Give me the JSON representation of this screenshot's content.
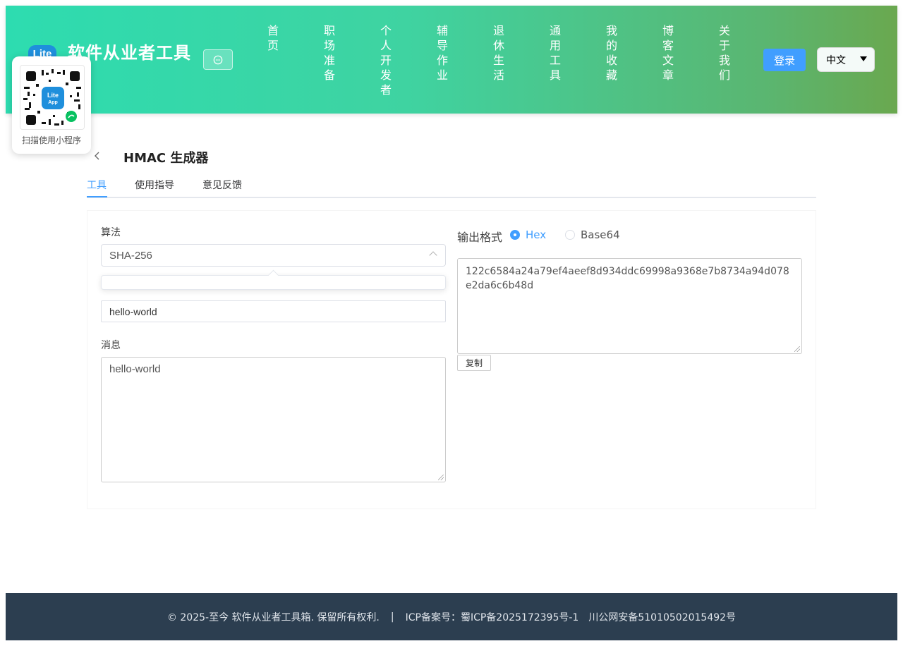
{
  "header": {
    "logo_text": "Lite",
    "site_title": "软件从业者工具",
    "nav": [
      "首页",
      "职场准备",
      "个人开发者",
      "辅导作业",
      "退休生活",
      "通用工具",
      "我的收藏",
      "博客文章",
      "关于我们"
    ],
    "login_label": "登录",
    "language": "中文",
    "gradient_colors": [
      "#2ddcb0",
      "#6aa84f"
    ]
  },
  "qr_popup": {
    "badge_text": "Lite App",
    "caption": "扫描使用小程序"
  },
  "tool": {
    "title": "HMAC 生成器",
    "tabs": [
      {
        "label": "工具",
        "active": true
      },
      {
        "label": "使用指导",
        "active": false
      },
      {
        "label": "意见反馈",
        "active": false
      }
    ]
  },
  "form": {
    "algorithm_label": "算法",
    "algorithm_value": "SHA-256",
    "key_value": "hello-world",
    "message_label": "消息",
    "message_value": "hello-world"
  },
  "output": {
    "format_label": "输出格式",
    "options": [
      {
        "label": "Hex",
        "checked": true
      },
      {
        "label": "Base64",
        "checked": false
      }
    ],
    "result": "122c6584a24a79ef4aeef8d934ddc69998a9368e7b8734a94d078e2da6c6b48d",
    "copy_label": "复制"
  },
  "footer": {
    "copyright": "© 2025-至今 软件从业者工具箱. 保留所有权利.",
    "separator": "|",
    "icp": "ICP备案号：蜀ICP备2025172395号-1",
    "police": "川公网安备51010502015492号"
  },
  "colors": {
    "accent": "#409eff",
    "footer_bg": "#2c3e50"
  }
}
